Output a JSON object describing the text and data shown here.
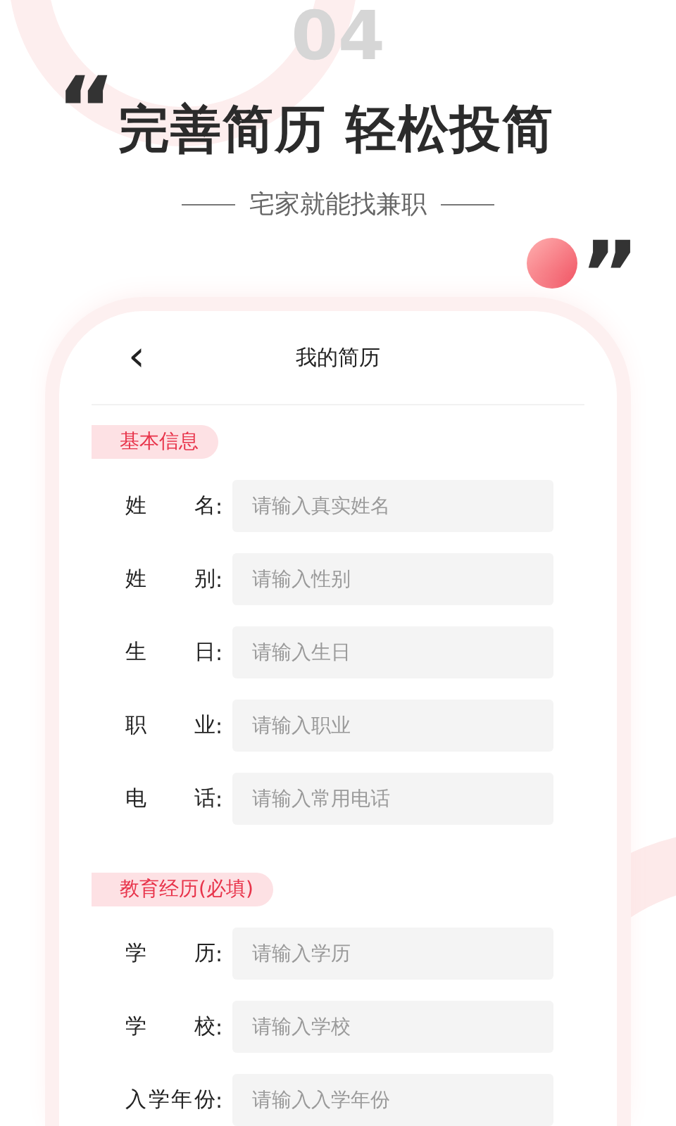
{
  "banner": {
    "number": "04",
    "open_quote": "“",
    "headline": "完善简历 轻松投简",
    "tagline": "宅家就能找兼职",
    "close_quote": "”"
  },
  "phone": {
    "back": "‹",
    "title": "我的简历",
    "sections": [
      {
        "title": "基本信息",
        "fields": [
          {
            "label": "姓名",
            "colon": ":",
            "placeholder": "请输入真实姓名"
          },
          {
            "label": "姓别",
            "colon": ":",
            "placeholder": "请输入性别"
          },
          {
            "label": "生日",
            "colon": ":",
            "placeholder": "请输入生日"
          },
          {
            "label": "职业",
            "colon": ":",
            "placeholder": "请输入职业"
          },
          {
            "label": "电话",
            "colon": ":",
            "placeholder": "请输入常用电话"
          }
        ]
      },
      {
        "title": "教育经历(必填)",
        "fields": [
          {
            "label": "学历",
            "colon": ":",
            "placeholder": "请输入学历"
          },
          {
            "label": "学校",
            "colon": ":",
            "placeholder": "请输入学校"
          },
          {
            "label": "入学年份",
            "colon": ":",
            "placeholder": "请输入入学年份"
          }
        ]
      }
    ]
  }
}
